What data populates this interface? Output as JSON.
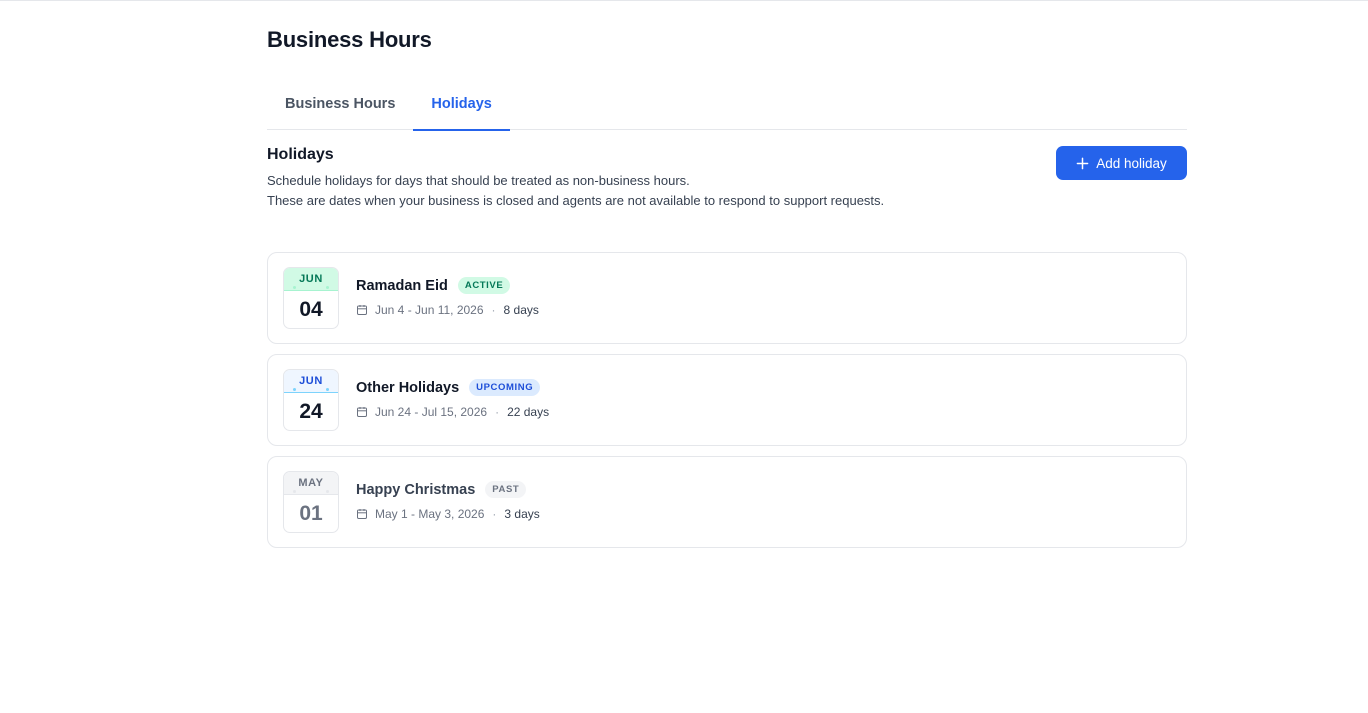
{
  "page": {
    "title": "Business Hours"
  },
  "tabs": [
    {
      "label": "Business Hours",
      "active": false
    },
    {
      "label": "Holidays",
      "active": true
    }
  ],
  "section": {
    "title": "Holidays",
    "description_line1": "Schedule holidays for days that should be treated as non-business hours.",
    "description_line2": "These are dates when your business is closed and agents are not available to respond to support requests."
  },
  "add_button": {
    "label": "Add holiday",
    "icon": "plus-icon"
  },
  "holidays": [
    {
      "month": "JUN",
      "day": "04",
      "name": "Ramadan Eid",
      "status": "ACTIVE",
      "date_range": "Jun 4 - Jun 11, 2026",
      "duration": "8 days",
      "colors": {
        "month_bg": "#d1fae5",
        "month_text": "#047857",
        "day_text": "#111827",
        "badge_bg": "#d1fae5",
        "badge_text": "#047857",
        "dot": "#a7f3d0"
      }
    },
    {
      "month": "JUN",
      "day": "24",
      "name": "Other Holidays",
      "status": "UPCOMING",
      "date_range": "Jun 24 - Jul 15, 2026",
      "duration": "22 days",
      "colors": {
        "month_bg": "#eff6ff",
        "month_text": "#1d4ed8",
        "day_text": "#111827",
        "badge_bg": "#dbeafe",
        "badge_text": "#1d4ed8",
        "dot": "#7dd3fc"
      }
    },
    {
      "month": "MAY",
      "day": "01",
      "name": "Happy Christmas",
      "status": "PAST",
      "date_range": "May 1 - May 3, 2026",
      "duration": "3 days",
      "colors": {
        "month_bg": "#f3f4f6",
        "month_text": "#6b7280",
        "day_text": "#6b7280",
        "badge_bg": "#f3f4f6",
        "badge_text": "#6b7280",
        "dot": "#e5e7eb"
      }
    }
  ]
}
